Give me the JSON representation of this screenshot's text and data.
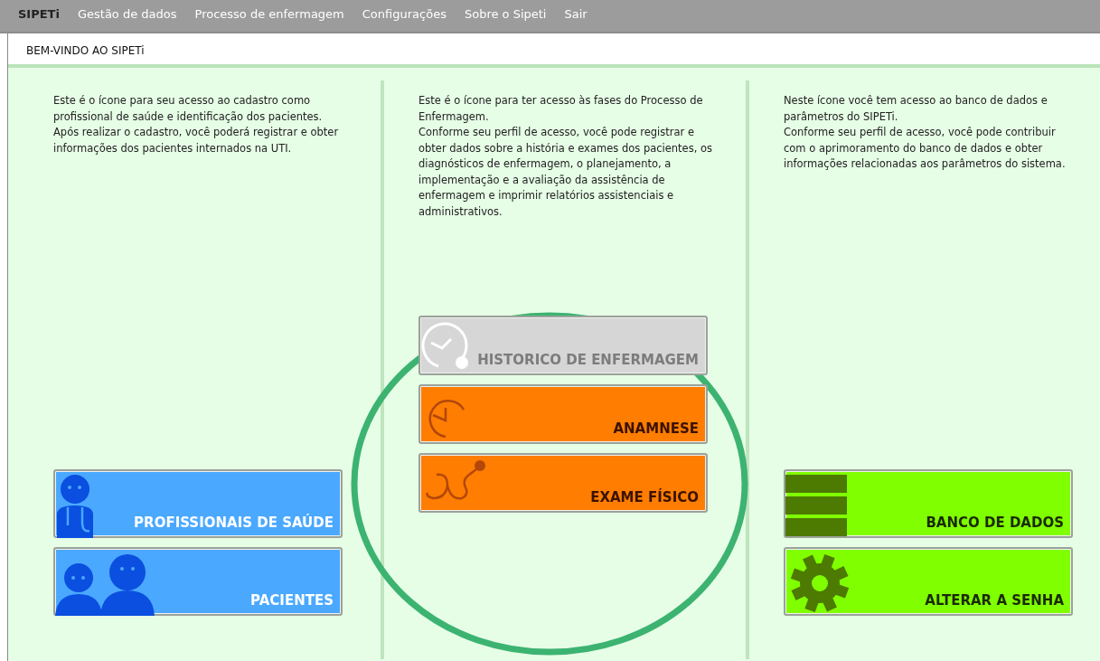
{
  "menu": {
    "brand": "SIPETi",
    "items": [
      {
        "label": "Gestão de dados"
      },
      {
        "label": "Processo de enfermagem"
      },
      {
        "label": "Configurações"
      },
      {
        "label": "Sobre o Sipeti"
      },
      {
        "label": "Sair"
      }
    ]
  },
  "panel": {
    "title": "BEM-VINDO AO SIPETi"
  },
  "columns": [
    {
      "description": [
        "Este é o ícone para seu acesso ao cadastro como profissional de saúde e identificação dos pacientes.",
        "Após realizar o cadastro, você poderá registrar e obter informações dos pacientes internados na UTI."
      ],
      "tiles": [
        {
          "label": "PROFISSIONAIS DE SAÚDE",
          "kind": "doctor",
          "color": "#4aa8ff",
          "disabled": false
        },
        {
          "label": "PACIENTES",
          "kind": "people",
          "color": "#4aa8ff",
          "disabled": false
        }
      ]
    },
    {
      "description": [
        "Este é o ícone para ter acesso às fases do Processo de Enfermagem.",
        "Conforme seu perfil de acesso, você pode registrar e obter dados sobre a história e exames dos pacientes, os diagnósticos de enfermagem, o planejamento, a implementação e a avaliação da assistência de enfermagem e imprimir relatórios assistenciais e administrativos."
      ],
      "tiles": [
        {
          "label": "HISTORICO DE ENFERMAGEM",
          "kind": "history",
          "color": "#d6d6d6",
          "disabled": true
        },
        {
          "label": "ANAMNESE",
          "kind": "clock",
          "color": "#ff7d00",
          "disabled": false
        },
        {
          "label": "EXAME FÍSICO",
          "kind": "stethoscope",
          "color": "#ff7d00",
          "disabled": false
        }
      ]
    },
    {
      "description": [
        "Neste ícone você tem acesso ao banco de dados e parâmetros do SIPETi.",
        "Conforme seu perfil de acesso, você pode contribuir com o aprimoramento do banco de dados e obter informações relacionadas aos parâmetros do sistema."
      ],
      "tiles": [
        {
          "label": "BANCO DE DADOS",
          "kind": "database",
          "color": "#80ff00",
          "disabled": false
        },
        {
          "label": "ALTERAR A SENHA",
          "kind": "gear",
          "color": "#80ff00",
          "disabled": false
        }
      ]
    }
  ]
}
